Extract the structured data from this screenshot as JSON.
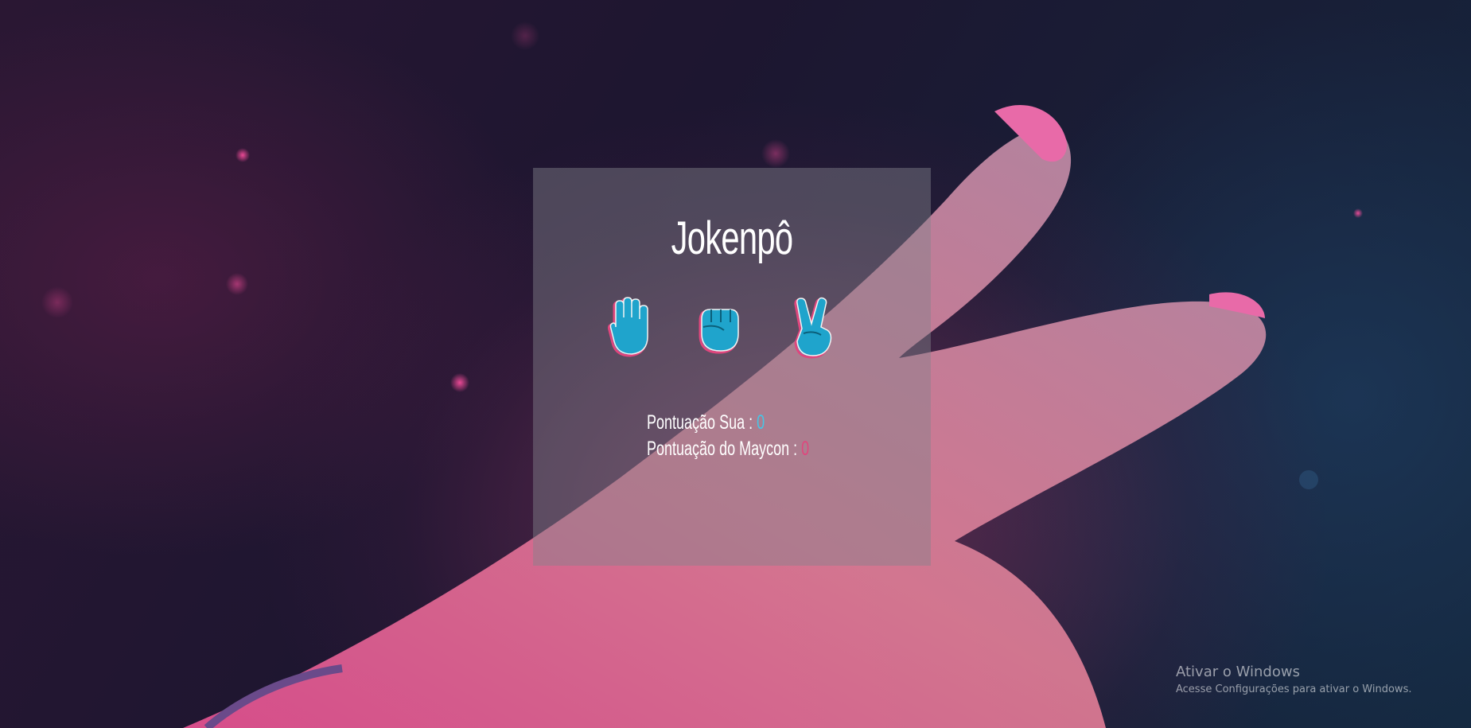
{
  "game": {
    "title": "Jokenpô",
    "choices": [
      {
        "name": "paper",
        "icon": "raised-hand-icon"
      },
      {
        "name": "rock",
        "icon": "raised-fist-icon"
      },
      {
        "name": "scissors",
        "icon": "victory-hand-icon"
      }
    ],
    "scores": {
      "you_label": "Pontuação Sua : ",
      "you_value": "0",
      "cpu_label": "Pontuação do Maycon : ",
      "cpu_value": "0"
    }
  },
  "watermark": {
    "title": "Ativar o Windows",
    "subtitle": "Acesse Configurações para ativar o Windows."
  },
  "colors": {
    "panel": "#82828c",
    "icon_fill": "#1fa4cc",
    "icon_outline": "#e0467d",
    "score_you": "#45c6e6",
    "score_cpu": "#e0467d"
  }
}
